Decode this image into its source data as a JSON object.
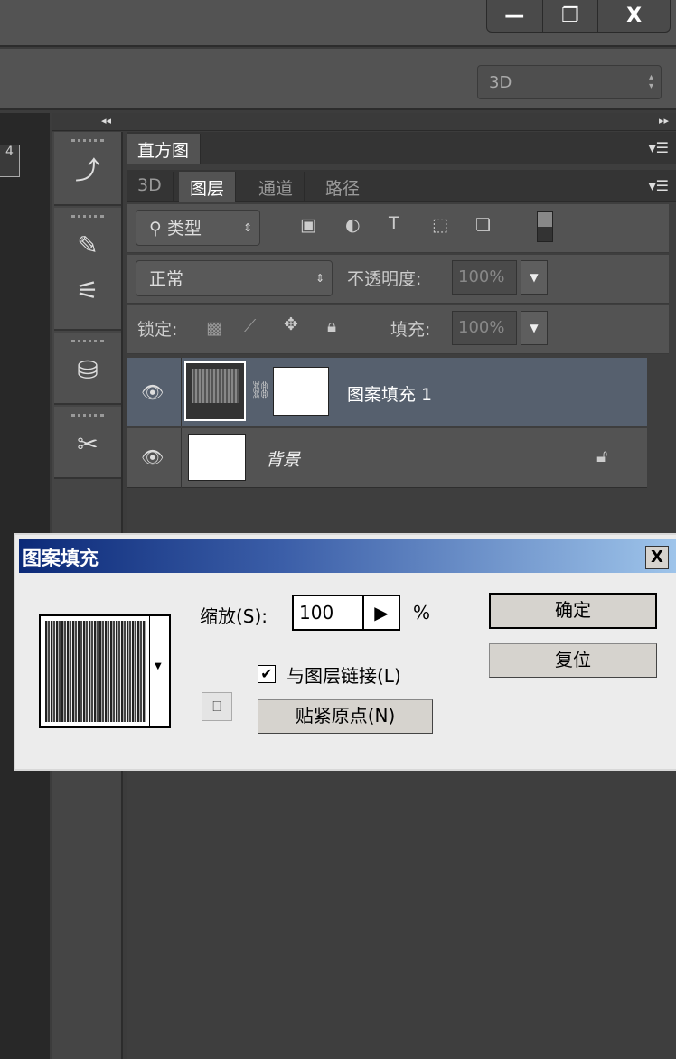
{
  "window": {
    "minimize": "—",
    "restore": "❐",
    "close": "X"
  },
  "options_bar": {
    "workspace": "3D"
  },
  "collapse": {
    "left": "◂◂",
    "right": "▸▸"
  },
  "ruler": {
    "label": "4"
  },
  "histogram_tab": "直方图",
  "tabs": [
    {
      "label": "3D"
    },
    {
      "label": "图层"
    },
    {
      "label": "通道"
    },
    {
      "label": "路径"
    }
  ],
  "filter": {
    "label": "类型"
  },
  "blend": {
    "mode": "正常",
    "opacity_label": "不透明度:",
    "opacity": "100%"
  },
  "lock": {
    "label": "锁定:",
    "fill_label": "填充:",
    "fill": "100%"
  },
  "layers": [
    {
      "name": "图案填充 1",
      "selected": true
    },
    {
      "name": "背景",
      "locked": true
    }
  ],
  "dialog": {
    "title": "图案填充",
    "close": "X",
    "scale_label": "缩放(S):",
    "scale": "100",
    "percent": "%",
    "ok": "确定",
    "reset": "复位",
    "link_label": "与图层链接(L)",
    "link_checked": true,
    "snap": "贴紧原点(N)"
  }
}
